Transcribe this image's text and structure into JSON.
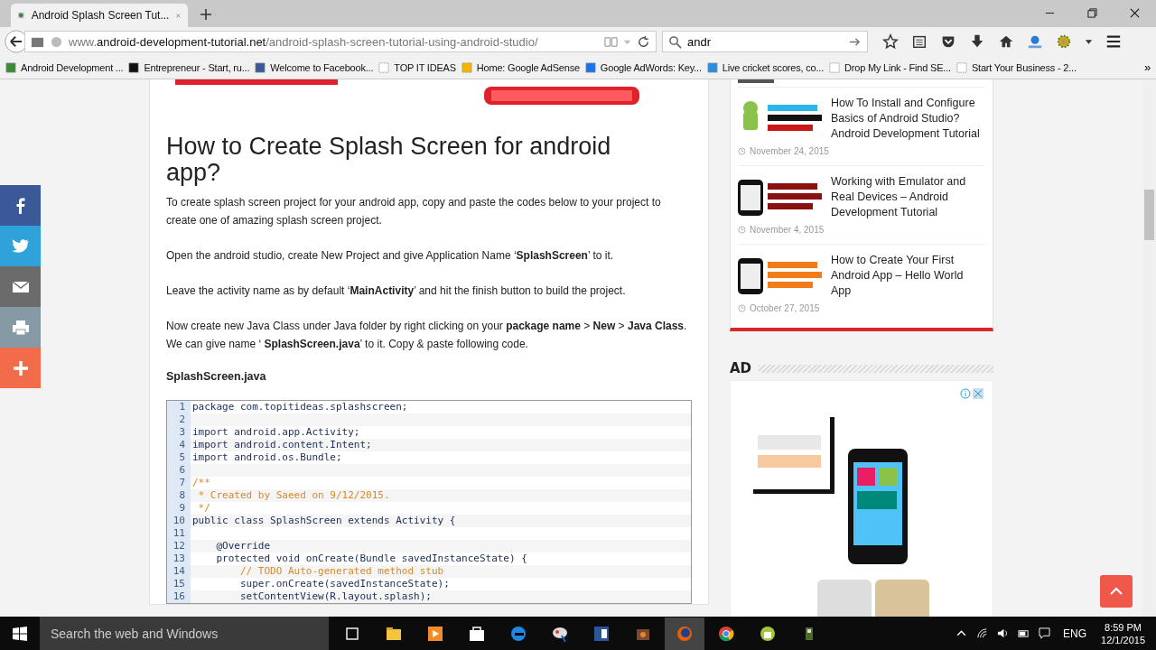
{
  "browser": {
    "tab": {
      "title": "Android Splash Screen Tut..."
    },
    "address": {
      "prefix": "www.",
      "domain": "android-development-tutorial.net",
      "path": "/android-splash-screen-tutorial-using-android-studio/"
    },
    "search": {
      "value": "andr"
    },
    "bookmarks": [
      "Android Development ...",
      "Entrepreneur - Start, ru...",
      "Welcome to Facebook...",
      "TOP IT IDEAS",
      "Home: Google AdSense",
      "Google AdWords: Key...",
      "Live cricket scores, co...",
      "Drop My Link - Find SE...",
      "Start Your Business - 2..."
    ],
    "bookmarks_overflow": "»"
  },
  "share": [
    {
      "kind": "facebook",
      "color": "#3b5998"
    },
    {
      "kind": "twitter",
      "color": "#2fa3d9"
    },
    {
      "kind": "email",
      "color": "#6b6b6b"
    },
    {
      "kind": "print",
      "color": "#869aa5"
    },
    {
      "kind": "more",
      "color": "#f26b4a"
    }
  ],
  "article": {
    "heading": "How to Create Splash Screen for android app?",
    "paragraphs": [
      "To create splash screen project for your android app, copy and paste the codes below to your project to create one of amazing splash screen project.",
      "Open the android studio, create New Project and give Application Name ‘**SplashScreen**’ to it.",
      "Leave the activity name as by default ‘**MainActivity**’ and hit the finish button to build the project.",
      "Now create new Java Class under Java folder by right clicking on your **package name** > **New** > **Java Class**. We can give name ‘ **SplashScreen.java**’ to it. Copy & paste following code."
    ],
    "file_label": "SplashScreen.java",
    "code": [
      {
        "n": "1",
        "text": "package com.topitideas.splashscreen;",
        "kind": "code"
      },
      {
        "n": "2"
      },
      {
        "n": "3",
        "text": "import android.app.Activity;",
        "kind": "code"
      },
      {
        "n": "4",
        "text": "import android.content.Intent;",
        "kind": "code"
      },
      {
        "n": "5",
        "text": "import android.os.Bundle;",
        "kind": "code"
      },
      {
        "n": "6"
      },
      {
        "n": "7",
        "text": "/**",
        "kind": "comment"
      },
      {
        "n": "8",
        "text": " * Created by Saeed on 9/12/2015.",
        "kind": "comment"
      },
      {
        "n": "9",
        "text": " */",
        "kind": "comment"
      },
      {
        "n": "10",
        "text": "public class SplashScreen extends Activity {",
        "kind": "code"
      },
      {
        "n": "11"
      },
      {
        "n": "12",
        "text": "    @Override",
        "kind": "code"
      },
      {
        "n": "13",
        "text": "    protected void onCreate(Bundle savedInstanceState) {",
        "kind": "code"
      },
      {
        "n": "14",
        "text": "        // TODO Auto-generated method stub",
        "kind": "comment"
      },
      {
        "n": "15",
        "text": "        super.onCreate(savedInstanceState);",
        "kind": "code"
      },
      {
        "n": "16",
        "text": "        setContentView(R.layout.splash);",
        "kind": "code"
      }
    ]
  },
  "sidebar": {
    "posts": [
      {
        "title": "How To Install and Configure Basics of Android Studio? Android Development Tutorial",
        "date": "November 24, 2015"
      },
      {
        "title": "Working with Emulator and Real Devices – Android Development Tutorial",
        "date": "November 4, 2015"
      },
      {
        "title": "How to Create Your First Android App – Hello World App",
        "date": "October 27, 2015"
      }
    ],
    "ad_heading": "AD"
  },
  "taskbar": {
    "search_placeholder": "Search the web and Windows",
    "language": "ENG",
    "time": "8:59 PM",
    "date": "12/1/2015"
  }
}
